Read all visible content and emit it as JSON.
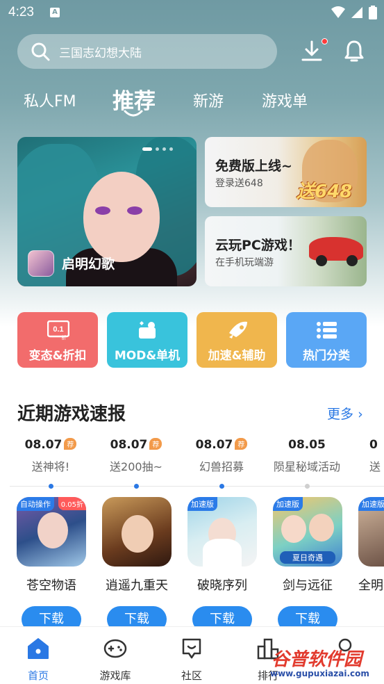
{
  "status": {
    "time": "4:23",
    "indicator": "A"
  },
  "search": {
    "placeholder": "三国志幻想大陆"
  },
  "tabs": [
    {
      "label": "私人FM"
    },
    {
      "label": "推荐",
      "active": true
    },
    {
      "label": "新游"
    },
    {
      "label": "游戏单"
    }
  ],
  "banner_main": {
    "game_name": "启明幻歌",
    "pages": 4,
    "current_page": 1
  },
  "banner_side": [
    {
      "title": "免费版上线~",
      "subtitle": "登录送648",
      "tag": "送648"
    },
    {
      "title": "云玩PC游戏！",
      "subtitle": "在手机玩端游"
    }
  ],
  "quick_actions": [
    {
      "label": "变态&折扣",
      "icon": "discount-icon",
      "icon_text": "0.1",
      "icon_sub": "折",
      "color": "#f26c6c"
    },
    {
      "label": "MOD&单机",
      "icon": "mod-icon",
      "color": "#39c3dc"
    },
    {
      "label": "加速&辅助",
      "icon": "rocket-icon",
      "color": "#f0b64d"
    },
    {
      "label": "热门分类",
      "icon": "list-icon",
      "color": "#5aa7f5"
    }
  ],
  "section": {
    "title": "近期游戏速报",
    "more": "更多"
  },
  "news": [
    {
      "date": "08.07",
      "tag": "荐",
      "desc": "送神将!"
    },
    {
      "date": "08.07",
      "tag": "荐",
      "desc": "送200抽~"
    },
    {
      "date": "08.07",
      "tag": "荐",
      "desc": "幻兽招募"
    },
    {
      "date": "08.05",
      "tag": "",
      "desc": "陨星秘域活动"
    },
    {
      "date": "0",
      "tag": "",
      "desc": "送"
    }
  ],
  "games": [
    {
      "name": "苍空物语",
      "badge": "自动操作",
      "badge2": "0.05折",
      "download": "下载"
    },
    {
      "name": "逍遥九重天",
      "badge": "",
      "badge2": "",
      "download": "下载"
    },
    {
      "name": "破晓序列",
      "badge": "加速版",
      "badge2": "",
      "download": "下载"
    },
    {
      "name": "剑与远征",
      "badge": "加速版",
      "badge2": "",
      "banner": "夏日奇遇",
      "download": "下载"
    },
    {
      "name": "全明",
      "badge": "加速版",
      "badge2": "",
      "download": ""
    }
  ],
  "bottom_nav": [
    {
      "label": "首页",
      "icon": "home-icon",
      "active": true
    },
    {
      "label": "游戏库",
      "icon": "gamepad-icon"
    },
    {
      "label": "社区",
      "icon": "community-icon"
    },
    {
      "label": "排行",
      "icon": "ranking-icon"
    },
    {
      "label": "",
      "icon": "profile-icon"
    }
  ],
  "watermark": {
    "name": "谷普软件园",
    "url": "www.gupuxiazai.com"
  },
  "colors": {
    "accent": "#2a78e4",
    "download": "#2a8cef",
    "header_bg": "#7ea7ae"
  }
}
